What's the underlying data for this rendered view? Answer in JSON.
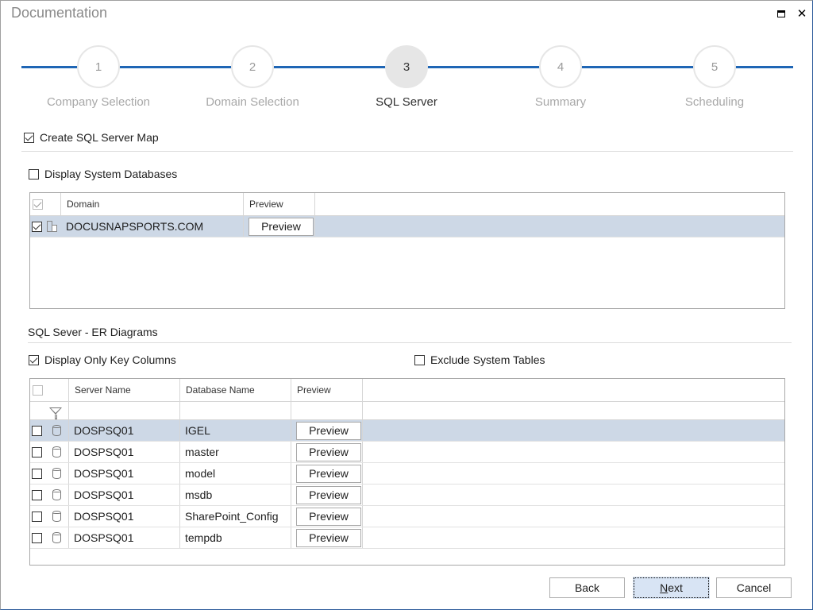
{
  "window": {
    "title": "Documentation",
    "controls": {
      "maximize_icon": "maximize-icon",
      "close_icon": "close-icon"
    }
  },
  "stepper": {
    "current_step": 3,
    "steps": [
      {
        "number": "1",
        "label": "Company Selection",
        "active": false
      },
      {
        "number": "2",
        "label": "Domain Selection",
        "active": false
      },
      {
        "number": "3",
        "label": "SQL Server",
        "active": true
      },
      {
        "number": "4",
        "label": "Summary",
        "active": false
      },
      {
        "number": "5",
        "label": "Scheduling",
        "active": false
      }
    ],
    "line_color": "#1f66b5"
  },
  "options": {
    "create_map": {
      "label": "Create SQL Server Map",
      "checked": true
    },
    "display_system_dbs": {
      "label": "Display System Databases",
      "checked": false
    }
  },
  "domain_grid": {
    "columns": [
      "Domain",
      "Preview"
    ],
    "select_all_checked": true,
    "rows": [
      {
        "checked": true,
        "icon": "server-icon",
        "domain": "DOCUSNAPSPORTS.COM",
        "preview_label": "Preview",
        "selected": true
      }
    ]
  },
  "er_section": {
    "title": "SQL Sever - ER Diagrams",
    "key_columns": {
      "label": "Display Only Key Columns",
      "checked": true
    },
    "exclude_system": {
      "label": "Exclude System Tables",
      "checked": false
    }
  },
  "db_grid": {
    "columns": [
      "Server Name",
      "Database Name",
      "Preview"
    ],
    "select_all_checked": false,
    "filter_icon": "filter-icon",
    "rows": [
      {
        "checked": false,
        "server": "DOSPSQ01",
        "database": "IGEL",
        "preview_label": "Preview",
        "selected": true
      },
      {
        "checked": false,
        "server": "DOSPSQ01",
        "database": "master",
        "preview_label": "Preview",
        "selected": false
      },
      {
        "checked": false,
        "server": "DOSPSQ01",
        "database": "model",
        "preview_label": "Preview",
        "selected": false
      },
      {
        "checked": false,
        "server": "DOSPSQ01",
        "database": "msdb",
        "preview_label": "Preview",
        "selected": false
      },
      {
        "checked": false,
        "server": "DOSPSQ01",
        "database": "SharePoint_Config",
        "preview_label": "Preview",
        "selected": false
      },
      {
        "checked": false,
        "server": "DOSPSQ01",
        "database": "tempdb",
        "preview_label": "Preview",
        "selected": false
      }
    ]
  },
  "footer": {
    "back_label": "Back",
    "next_mnemonic": "N",
    "next_rest": "ext",
    "cancel_label": "Cancel"
  },
  "colors": {
    "selection_row": "#cdd8e6",
    "primary_button": "#d8e4f4"
  }
}
